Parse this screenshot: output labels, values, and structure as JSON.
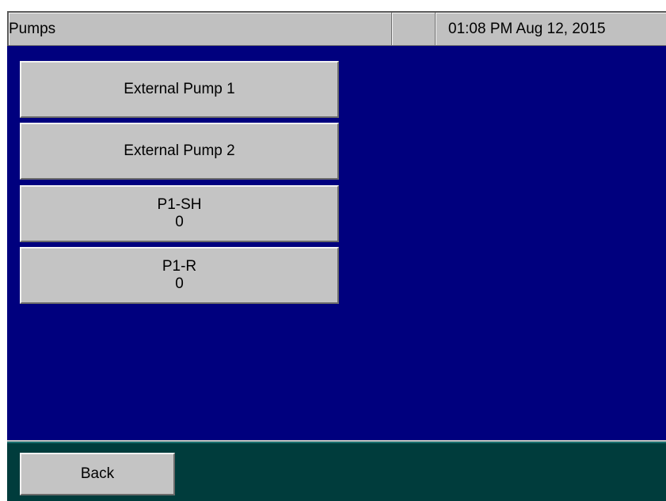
{
  "header": {
    "title": "Pumps",
    "blank": "",
    "datetime": "01:08 PM Aug 12, 2015"
  },
  "main": {
    "buttons": [
      {
        "label": "External Pump 1"
      },
      {
        "label": "External Pump 2"
      },
      {
        "label": "P1-SH",
        "value": "0"
      },
      {
        "label": "P1-R",
        "value": "0"
      }
    ]
  },
  "footer": {
    "back_label": "Back"
  },
  "colors": {
    "main_background": "#00007e",
    "footer_background": "#003c3c",
    "button_face": "#c4c4c4",
    "header_background": "#c0c0c0"
  }
}
